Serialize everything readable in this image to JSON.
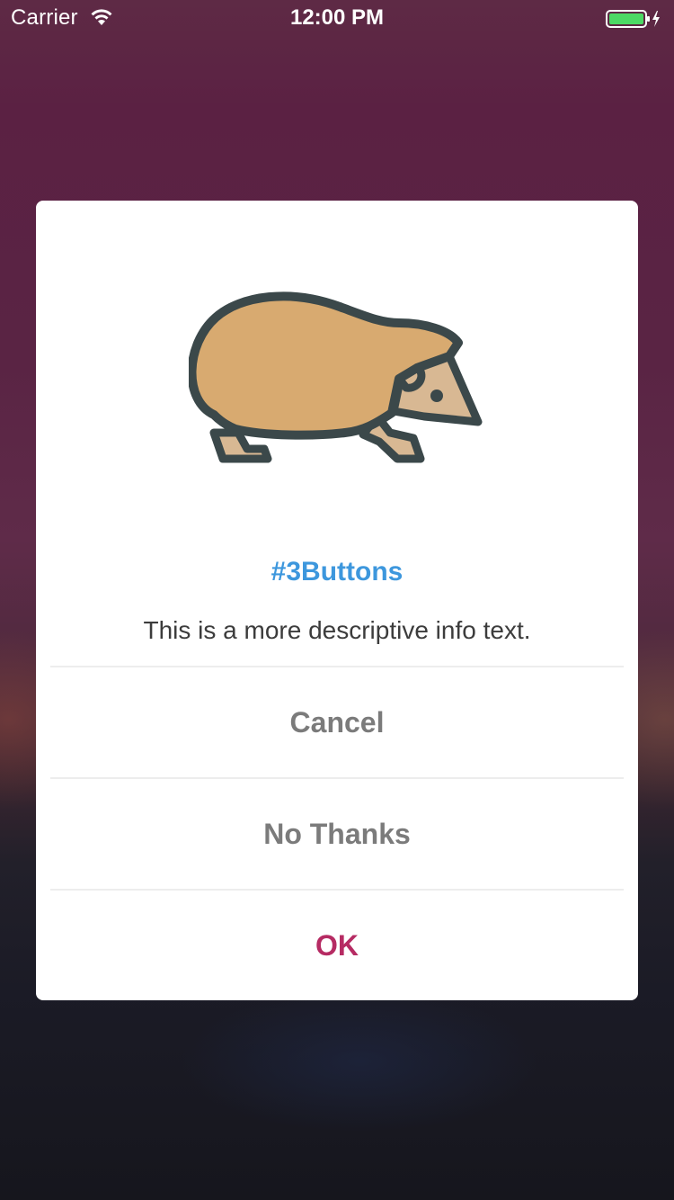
{
  "status_bar": {
    "carrier": "Carrier",
    "time": "12:00 PM",
    "wifi_icon": "wifi-icon",
    "battery_icon": "battery-charging-icon",
    "battery_color": "#4cd964"
  },
  "dialog": {
    "icon": "hedgehog-icon",
    "title": "#3Buttons",
    "title_color": "#3d97dd",
    "message": "This is a more descriptive info text.",
    "buttons": [
      {
        "label": "Cancel",
        "color": "#7b7b7b"
      },
      {
        "label": "No Thanks",
        "color": "#7b7b7b"
      },
      {
        "label": "OK",
        "color": "#b62b63"
      }
    ]
  }
}
